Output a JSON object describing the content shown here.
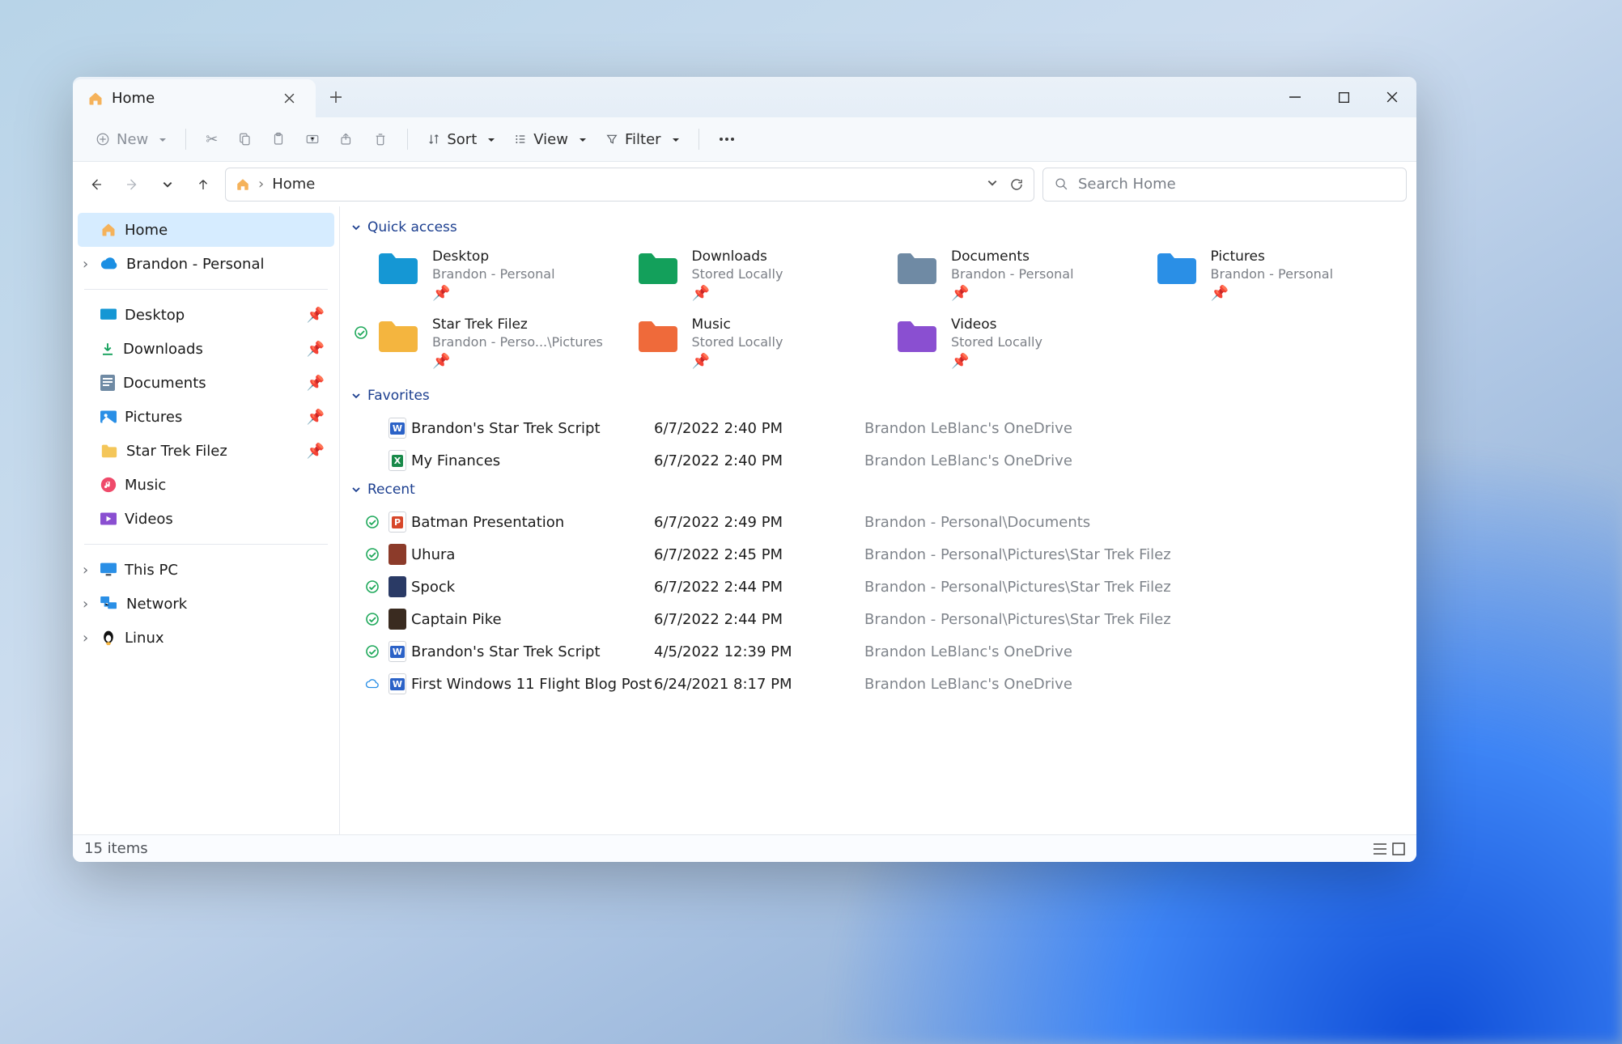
{
  "titlebar": {
    "tab_label": "Home"
  },
  "toolbar": {
    "new_label": "New",
    "sort_label": "Sort",
    "view_label": "View",
    "filter_label": "Filter"
  },
  "address": {
    "crumb": "Home",
    "search_placeholder": "Search Home"
  },
  "sidebar": {
    "home": "Home",
    "onedrive": "Brandon - Personal",
    "pinned": [
      {
        "label": "Desktop"
      },
      {
        "label": "Downloads"
      },
      {
        "label": "Documents"
      },
      {
        "label": "Pictures"
      },
      {
        "label": "Star Trek Filez"
      }
    ],
    "music": "Music",
    "videos": "Videos",
    "thispc": "This PC",
    "network": "Network",
    "linux": "Linux"
  },
  "sections": {
    "quick_access": "Quick access",
    "favorites": "Favorites",
    "recent": "Recent"
  },
  "quick_access": [
    {
      "title": "Desktop",
      "subtitle": "Brandon - Personal",
      "color": "#1597d4"
    },
    {
      "title": "Downloads",
      "subtitle": "Stored Locally",
      "color": "#13a05b"
    },
    {
      "title": "Documents",
      "subtitle": "Brandon - Personal",
      "color": "#6f8aa4"
    },
    {
      "title": "Pictures",
      "subtitle": "Brandon - Personal",
      "color": "#2a8fe6"
    },
    {
      "title": "Star Trek Filez",
      "subtitle": "Brandon - Perso...\\Pictures",
      "color": "#f4b53f",
      "status": "sync"
    },
    {
      "title": "Music",
      "subtitle": "Stored Locally",
      "color": "#ef6a3a"
    },
    {
      "title": "Videos",
      "subtitle": "Stored Locally",
      "color": "#8a4fd1"
    }
  ],
  "favorites": [
    {
      "icon": "word",
      "name": "Brandon's Star Trek Script",
      "date": "6/7/2022 2:40 PM",
      "loc": "Brandon LeBlanc's OneDrive"
    },
    {
      "icon": "excel",
      "name": "My Finances",
      "date": "6/7/2022 2:40 PM",
      "loc": "Brandon LeBlanc's OneDrive"
    }
  ],
  "recent": [
    {
      "status": "sync",
      "icon": "ppt",
      "name": "Batman Presentation",
      "date": "6/7/2022 2:49 PM",
      "loc": "Brandon - Personal\\Documents"
    },
    {
      "status": "sync",
      "icon": "img1",
      "name": "Uhura",
      "date": "6/7/2022 2:45 PM",
      "loc": "Brandon - Personal\\Pictures\\Star Trek Filez"
    },
    {
      "status": "sync",
      "icon": "img2",
      "name": "Spock",
      "date": "6/7/2022 2:44 PM",
      "loc": "Brandon - Personal\\Pictures\\Star Trek Filez"
    },
    {
      "status": "sync",
      "icon": "img3",
      "name": "Captain Pike",
      "date": "6/7/2022 2:44 PM",
      "loc": "Brandon - Personal\\Pictures\\Star Trek Filez"
    },
    {
      "status": "sync",
      "icon": "word",
      "name": "Brandon's Star Trek Script",
      "date": "4/5/2022 12:39 PM",
      "loc": "Brandon LeBlanc's OneDrive"
    },
    {
      "status": "cloud",
      "icon": "word",
      "name": "First Windows 11 Flight Blog Post",
      "date": "6/24/2021 8:17 PM",
      "loc": "Brandon LeBlanc's OneDrive"
    }
  ],
  "statusbar": {
    "count": "15 items"
  }
}
